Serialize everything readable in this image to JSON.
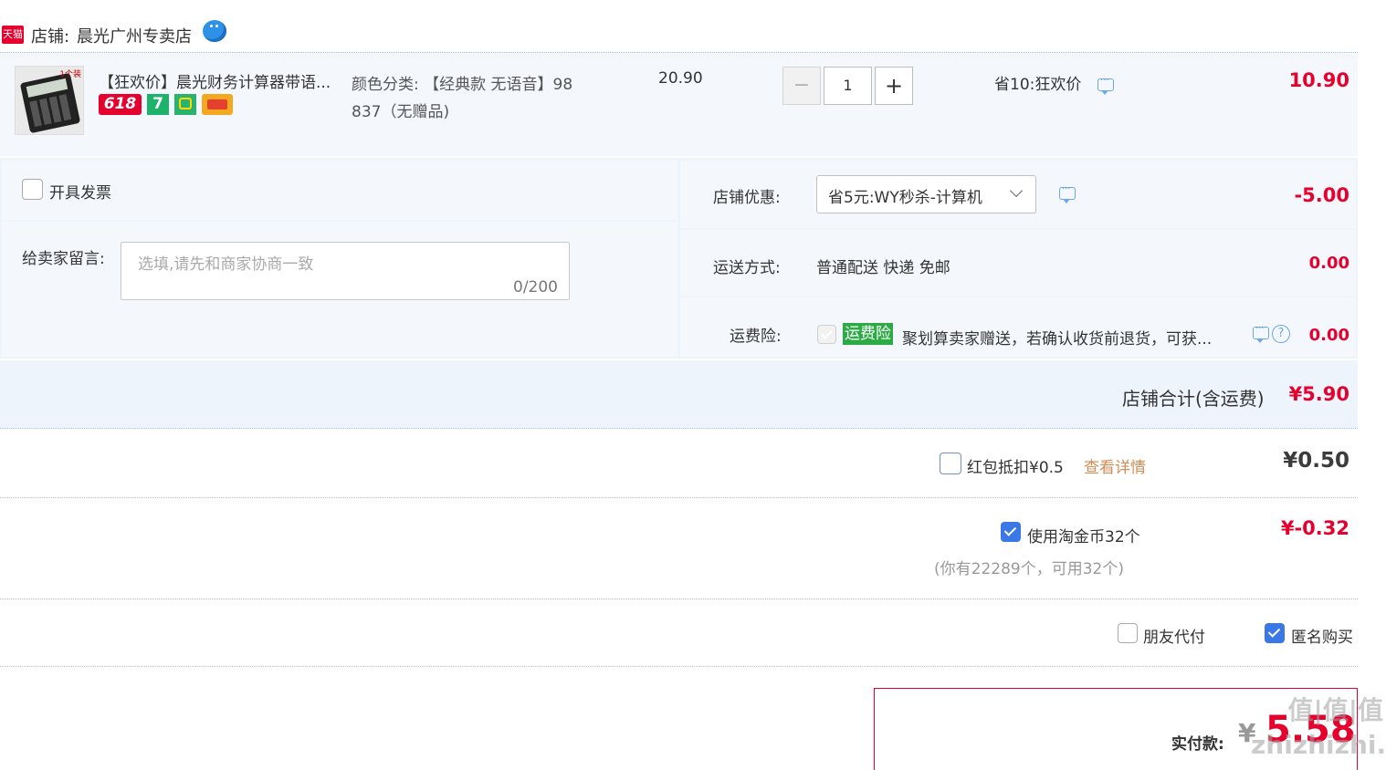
{
  "shop": {
    "badge": "天猫",
    "label": "店铺:",
    "name": "晨光广州专卖店"
  },
  "item": {
    "title": "【狂欢价】晨光财务计算器带语...",
    "sku_line1": "颜色分类: 【经典款 无语音】98",
    "sku_line2": "837（无赠品)",
    "unit_price": "20.90",
    "quantity": "1",
    "minus": "−",
    "plus": "+",
    "promo": "省10:狂欢价",
    "subtotal": "10.90",
    "thumb_tag": "1个装",
    "badge_618": "618",
    "badge_7": "7"
  },
  "invoice": {
    "label": "开具发票"
  },
  "message": {
    "label": "给卖家留言:",
    "placeholder": "选填,请先和商家协商一致",
    "counter": "0/200"
  },
  "coupon": {
    "label": "店铺优惠:",
    "selected": "省5元:WY秒杀-计算机",
    "amount": "-5.00"
  },
  "shipping": {
    "label": "运送方式:",
    "value": "普通配送 快递 免邮",
    "amount": "0.00"
  },
  "insurance": {
    "label": "运费险:",
    "tag": "运费险",
    "text": "聚划算卖家赠送，若确认收货前退货，可获...",
    "help": "?",
    "amount": "0.00"
  },
  "shop_total": {
    "label": "店铺合计(含运费)",
    "amount": "¥5.90"
  },
  "redpacket": {
    "label": "红包抵扣¥0.5",
    "link": "查看详情",
    "amount": "¥0.50"
  },
  "coins": {
    "label": "使用淘金币32个",
    "note": "(你有22289个，可用32个)",
    "amount": "¥-0.32"
  },
  "options": {
    "friend_pay": "朋友代付",
    "anonymous": "匿名购买"
  },
  "pay": {
    "label": "实付款:",
    "currency": "¥",
    "amount": "5.58"
  },
  "watermark": "值|值|值 zhizhizhi.com"
}
